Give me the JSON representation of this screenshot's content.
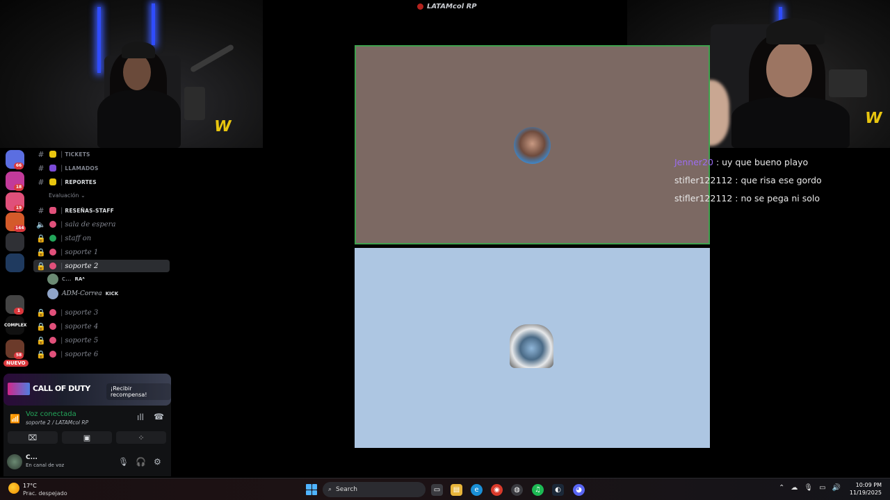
{
  "stream": {
    "app_title": "LATAMcol RP"
  },
  "discord": {
    "servers": [
      {
        "name": "server-1",
        "badge": "66",
        "color": "#5b6ee1"
      },
      {
        "name": "server-2",
        "badge": "18",
        "color": "#c23a9a"
      },
      {
        "name": "server-3",
        "badge": "19",
        "color": "#e0507a"
      },
      {
        "name": "server-4",
        "badge": "144",
        "color": "#d45a2a"
      },
      {
        "name": "server-5",
        "badge": "",
        "color": "#2f3035"
      },
      {
        "name": "server-6",
        "badge": "",
        "color": "#1f3a5f"
      },
      {
        "name": "server-7",
        "badge": "1",
        "color": "#444"
      },
      {
        "name": "server-8",
        "badge": "",
        "color": "#111"
      },
      {
        "name": "server-9",
        "badge": "58",
        "color": "#6b3a2a"
      }
    ],
    "server_label_complex": "COMPLEX",
    "nuevo_label": "NUEVO",
    "category_label": "Evaluación",
    "channels": [
      {
        "label": "TICKETS",
        "type": "text",
        "caps": true
      },
      {
        "label": "LLAMADOS",
        "type": "text",
        "caps": true
      },
      {
        "label": "REPORTES",
        "type": "text",
        "caps": true,
        "bright": true
      },
      {
        "label": "RESEÑAS-STAFF",
        "type": "text",
        "caps": true,
        "bright": true
      },
      {
        "label": "sala de espera",
        "type": "voice"
      },
      {
        "label": "staff on",
        "type": "voice"
      },
      {
        "label": "soporte 1",
        "type": "voice"
      },
      {
        "label": "soporte 2",
        "type": "voice",
        "active": true
      },
      {
        "label": "soporte 3",
        "type": "voice"
      },
      {
        "label": "soporte 4",
        "type": "voice"
      },
      {
        "label": "soporte 5",
        "type": "voice"
      },
      {
        "label": "soporte 6",
        "type": "voice"
      }
    ],
    "voice_users": [
      {
        "name": "c...",
        "tag": "RAᴬ"
      },
      {
        "name": "ADM-Correa",
        "tag": "KICK"
      }
    ],
    "promo": {
      "logo": "CALL OF DUTY",
      "button": "¡Recibir recompensa!"
    },
    "voice_panel": {
      "status": "Voz conectada",
      "channel": "soporte 2 / LATAMcol RP"
    },
    "user": {
      "name": "C...",
      "state": "En canal de voz"
    }
  },
  "chat": [
    {
      "user": "Jenner20",
      "text": " : uy que bueno playo",
      "color": "#9b6cf2"
    },
    {
      "user": "stifler122112",
      "text": " : que risa ese gordo",
      "color": "#e9e9e9"
    },
    {
      "user": "stifler122112",
      "text": " : no se pega ni solo",
      "color": "#e9e9e9"
    }
  ],
  "taskbar": {
    "weather_temp": "17°C",
    "weather_desc": "Prac. despejado",
    "search_label": "Search",
    "time": "10:09 PM",
    "date": "11/19/2025"
  },
  "colors": {
    "tile_top": "#7c6963",
    "tile_top_border": "#3fa14d",
    "tile_bottom": "#adc6e2",
    "discord_green": "#23a55a",
    "discord_red": "#da373c"
  }
}
